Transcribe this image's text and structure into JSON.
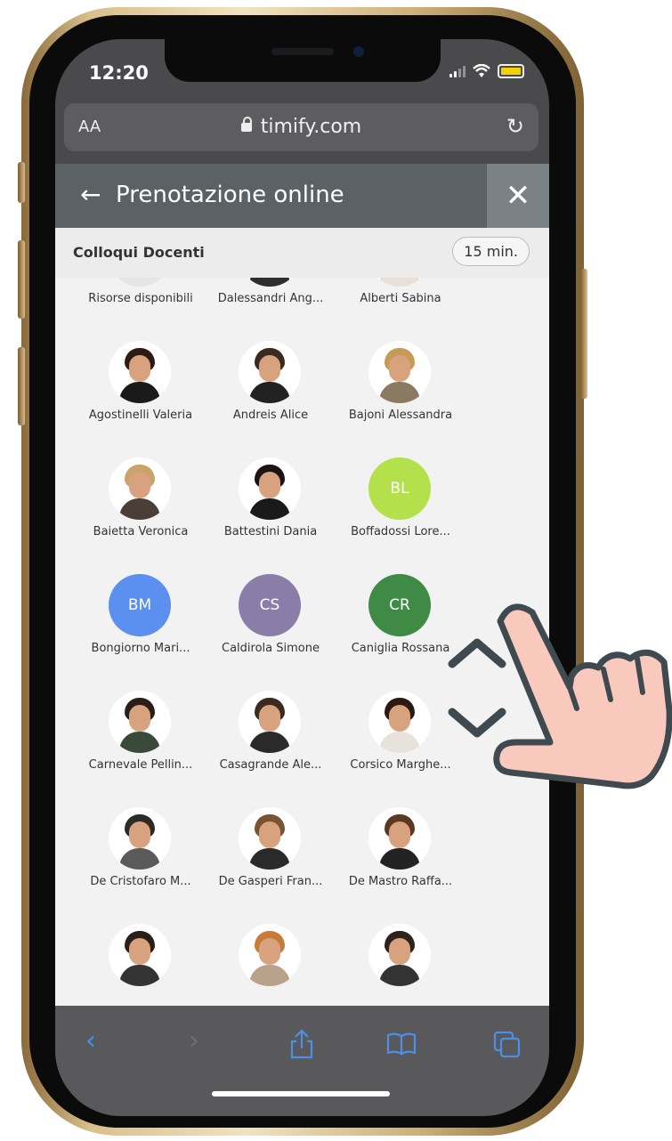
{
  "status": {
    "time": "12:20"
  },
  "browser": {
    "text_size": "AA",
    "domain": "timify.com"
  },
  "header": {
    "title": "Prenotazione online"
  },
  "service": {
    "name": "Colloqui Docenti",
    "duration": "15 min."
  },
  "resources": [
    {
      "name": "Risorse disponibili",
      "type": "all"
    },
    {
      "name": "Dalessandri Ang...",
      "type": "photo",
      "hair": "#4a4a4a",
      "shirt": "#2d2d2d"
    },
    {
      "name": "Alberti Sabina",
      "type": "photo",
      "hair": "#c8a56b",
      "shirt": "#e8e0d6"
    },
    {
      "name": "Agostinelli Valeria",
      "type": "photo",
      "hair": "#2b1b14",
      "shirt": "#1a1a1a"
    },
    {
      "name": "Andreis Alice",
      "type": "photo",
      "hair": "#3a2a20",
      "shirt": "#222222"
    },
    {
      "name": "Bajoni Alessandra",
      "type": "photo",
      "hair": "#c89a55",
      "shirt": "#8a7a62"
    },
    {
      "name": "Baietta Veronica",
      "type": "photo",
      "hair": "#c9a46a",
      "shirt": "#4a3e36"
    },
    {
      "name": "Battestini Dania",
      "type": "photo",
      "hair": "#1c1412",
      "shirt": "#1a1a1a"
    },
    {
      "name": "Boffadossi Lore...",
      "type": "initials",
      "initials": "BL",
      "color": "#b4e04c"
    },
    {
      "name": "Bongiorno Mari...",
      "type": "initials",
      "initials": "BM",
      "color": "#5b8ff0"
    },
    {
      "name": "Caldirola Simone",
      "type": "initials",
      "initials": "CS",
      "color": "#8a7ea8"
    },
    {
      "name": "Caniglia Rossana",
      "type": "initials",
      "initials": "CR",
      "color": "#3f8a45"
    },
    {
      "name": "Carnevale Pellin...",
      "type": "photo",
      "hair": "#2b1e16",
      "shirt": "#3a4a3a"
    },
    {
      "name": "Casagrande Ale...",
      "type": "photo",
      "hair": "#3a2a22",
      "shirt": "#2a2a2a"
    },
    {
      "name": "Corsico Marghe...",
      "type": "photo",
      "hair": "#2a1a12",
      "shirt": "#e8e2dc"
    },
    {
      "name": "De Cristofaro M...",
      "type": "photo",
      "hair": "#2e2a26",
      "shirt": "#5a5a5a"
    },
    {
      "name": "De Gasperi Fran...",
      "type": "photo",
      "hair": "#7a5234",
      "shirt": "#2a2a2a"
    },
    {
      "name": "De Mastro Raffa...",
      "type": "photo",
      "hair": "#5a3a20",
      "shirt": "#222222"
    },
    {
      "name": "",
      "type": "photo",
      "hair": "#2a1e18",
      "shirt": "#333333"
    },
    {
      "name": "",
      "type": "photo",
      "hair": "#c77a3a",
      "shirt": "#b8a28a"
    },
    {
      "name": "",
      "type": "photo",
      "hair": "#2e221c",
      "shirt": "#333333"
    }
  ],
  "colors": {
    "header_bg": "#5a6266",
    "toolbar_bg": "#59595b",
    "accent": "#4a90e8",
    "phone_gold": "#d9bf8c"
  },
  "icons": {
    "back": "arrow-left-icon",
    "close": "close-icon",
    "reload": "reload-icon",
    "lock": "lock-icon",
    "group": "group-icon",
    "toolbar": [
      "chevron-left-icon",
      "chevron-right-icon",
      "share-icon",
      "book-icon",
      "tabs-icon"
    ],
    "gesture": "hand-scroll-icon"
  }
}
